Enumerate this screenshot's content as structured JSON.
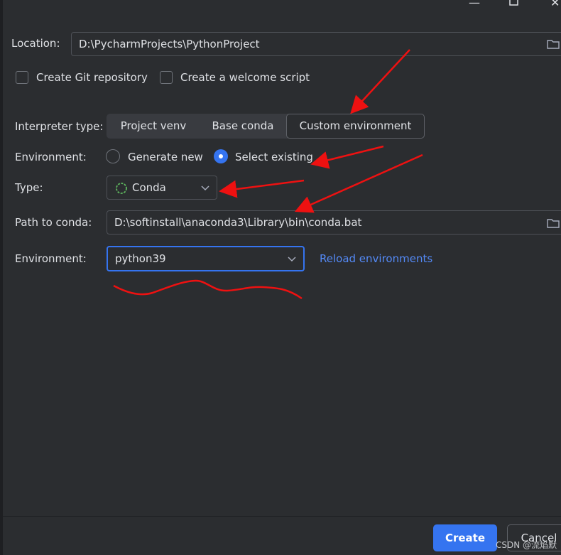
{
  "location": {
    "label": "Location:",
    "value": "D:\\PycharmProjects\\PythonProject"
  },
  "options": {
    "git_repo": "Create Git repository",
    "welcome_script": "Create a welcome script"
  },
  "interpreter": {
    "label": "Interpreter type:",
    "tabs": [
      "Project venv",
      "Base conda",
      "Custom environment"
    ],
    "selected": "Custom environment"
  },
  "environment_mode": {
    "label": "Environment:",
    "generate_new": "Generate new",
    "select_existing": "Select existing",
    "selected": "Select existing"
  },
  "type": {
    "label": "Type:",
    "value": "Conda"
  },
  "conda_path": {
    "label": "Path to conda:",
    "value": "D:\\softinstall\\anaconda3\\Library\\bin\\conda.bat"
  },
  "environment": {
    "label": "Environment:",
    "value": "python39",
    "reload_link": "Reload environments"
  },
  "footer": {
    "create": "Create",
    "cancel": "Cancel"
  },
  "watermark": "CSDN @流焰默",
  "colors": {
    "background": "#2b2d30",
    "accent": "#3574f0",
    "link": "#548af7",
    "annotation_red": "#ee1111"
  }
}
